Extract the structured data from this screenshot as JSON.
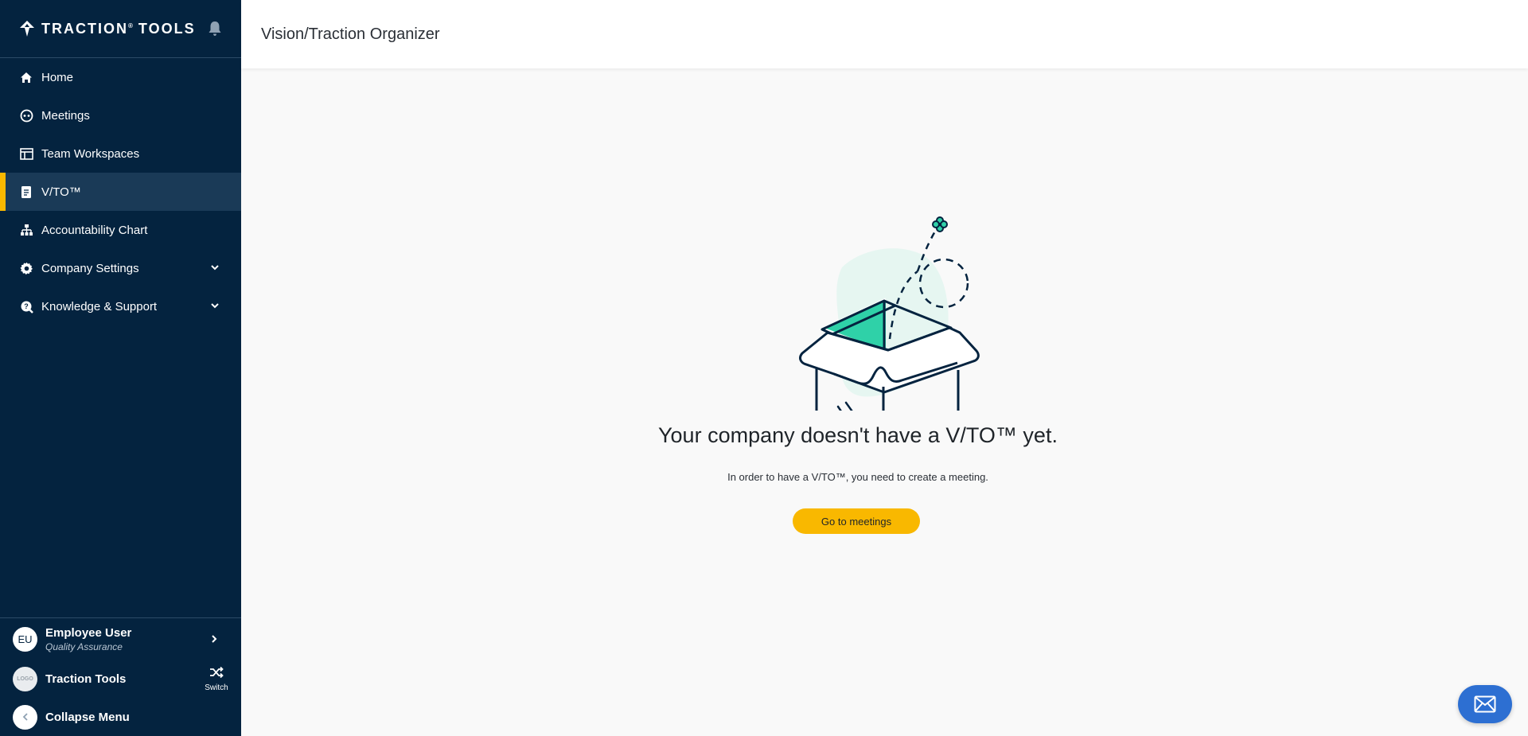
{
  "brand": {
    "name": "TRACTION",
    "reg": "®",
    "suffix": "TOOLS"
  },
  "page_title": "Vision/Traction Organizer",
  "nav": {
    "home": "Home",
    "meetings": "Meetings",
    "team_workspaces": "Team Workspaces",
    "vto": "V/TO™",
    "accountability_chart": "Accountability Chart",
    "company_settings": "Company Settings",
    "knowledge_support": "Knowledge & Support"
  },
  "user": {
    "initials": "EU",
    "name": "Employee User",
    "role": "Quality Assurance"
  },
  "org": {
    "logo_text": "LOGO",
    "name": "Traction Tools",
    "switch_label": "Switch"
  },
  "collapse_label": "Collapse Menu",
  "empty_state": {
    "headline": "Your company doesn't have a V/TO™ yet.",
    "subtext": "In order to have a V/TO™, you need to create a meeting.",
    "button": "Go to meetings"
  },
  "colors": {
    "sidebar": "#04233f",
    "accent": "#f9b800",
    "teal": "#2fd1a8",
    "fab": "#2d6fd2"
  },
  "icons": {
    "home": "home-icon",
    "meetings": "meetings-icon",
    "workspaces": "workspace-icon",
    "vto": "document-icon",
    "chart": "org-chart-icon",
    "settings": "gear-icon",
    "support": "support-icon",
    "bell": "bell-icon",
    "mail": "mail-icon"
  }
}
